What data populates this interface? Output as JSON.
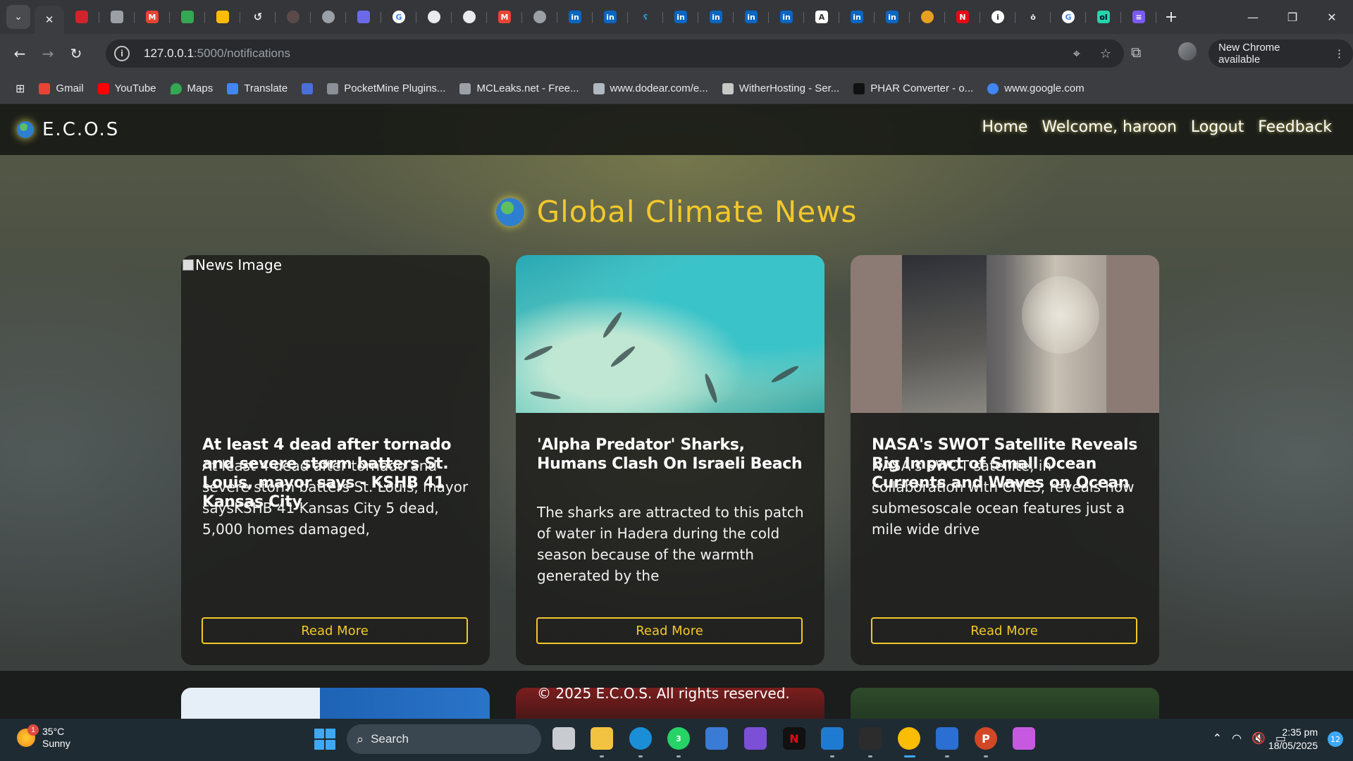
{
  "browser": {
    "active_tab_close": "✕",
    "url_host": "127.0.0.1",
    "url_path": ":5000/notifications",
    "new_chrome_label": "New Chrome available",
    "bookmarks": [
      {
        "label": "Gmail",
        "color": "#ea4335"
      },
      {
        "label": "YouTube",
        "color": "#ff0000"
      },
      {
        "label": "Maps",
        "color": "#34a853"
      },
      {
        "label": "Translate",
        "color": "#4285f4"
      },
      {
        "label": "",
        "color": "#4a6fd8"
      },
      {
        "label": "PocketMine Plugins...",
        "color": "#8a8f98"
      },
      {
        "label": "MCLeaks.net - Free...",
        "color": "#9aa0a6"
      },
      {
        "label": "www.dodear.com/e...",
        "color": "#b0b8c0"
      },
      {
        "label": "WitherHosting - Ser...",
        "color": "#c8c8c8"
      },
      {
        "label": "PHAR Converter - o...",
        "color": "#111111"
      },
      {
        "label": "www.google.com",
        "color": "#4285f4"
      }
    ]
  },
  "site": {
    "brand": "E.C.O.S",
    "nav": [
      {
        "label": "Home"
      },
      {
        "label": "Welcome, haroon"
      },
      {
        "label": "Logout"
      },
      {
        "label": "Feedback"
      }
    ],
    "heading": "Global Climate News",
    "accent_color": "#f2c82b",
    "cards": [
      {
        "image_alt": "News Image",
        "title": "At least 4 dead after tornado and severe storm batters St. Louis, mayor says - KSHB 41 Kansas City",
        "description": "At least 4 dead after tornado and severe storm batters St. Louis, mayor saysKSHB 41 Kansas City 5 dead, 5,000 homes damaged,",
        "button": "Read More"
      },
      {
        "title": "'Alpha Predator' Sharks, Humans Clash On Israeli Beach",
        "description": "The sharks are attracted to this patch of water in Hadera during the cold season because of the warmth generated by the",
        "button": "Read More"
      },
      {
        "title": "NASA's SWOT Satellite Reveals Big Impact of Small Ocean Currents and Waves on Ocean",
        "description": "NASA's SWOT satellite, in collaboration with CNES, reveals how submesoscale ocean features just a mile wide drive",
        "button": "Read More"
      }
    ],
    "footer": "© 2025 E.C.O.S. All rights reserved."
  },
  "taskbar": {
    "weather_temp": "35°C",
    "weather_cond": "Sunny",
    "weather_badge": "1",
    "search_label": "Search",
    "whatsapp_badge": "3",
    "time": "2:35 pm",
    "date": "18/05/2025",
    "notifications": "12"
  }
}
